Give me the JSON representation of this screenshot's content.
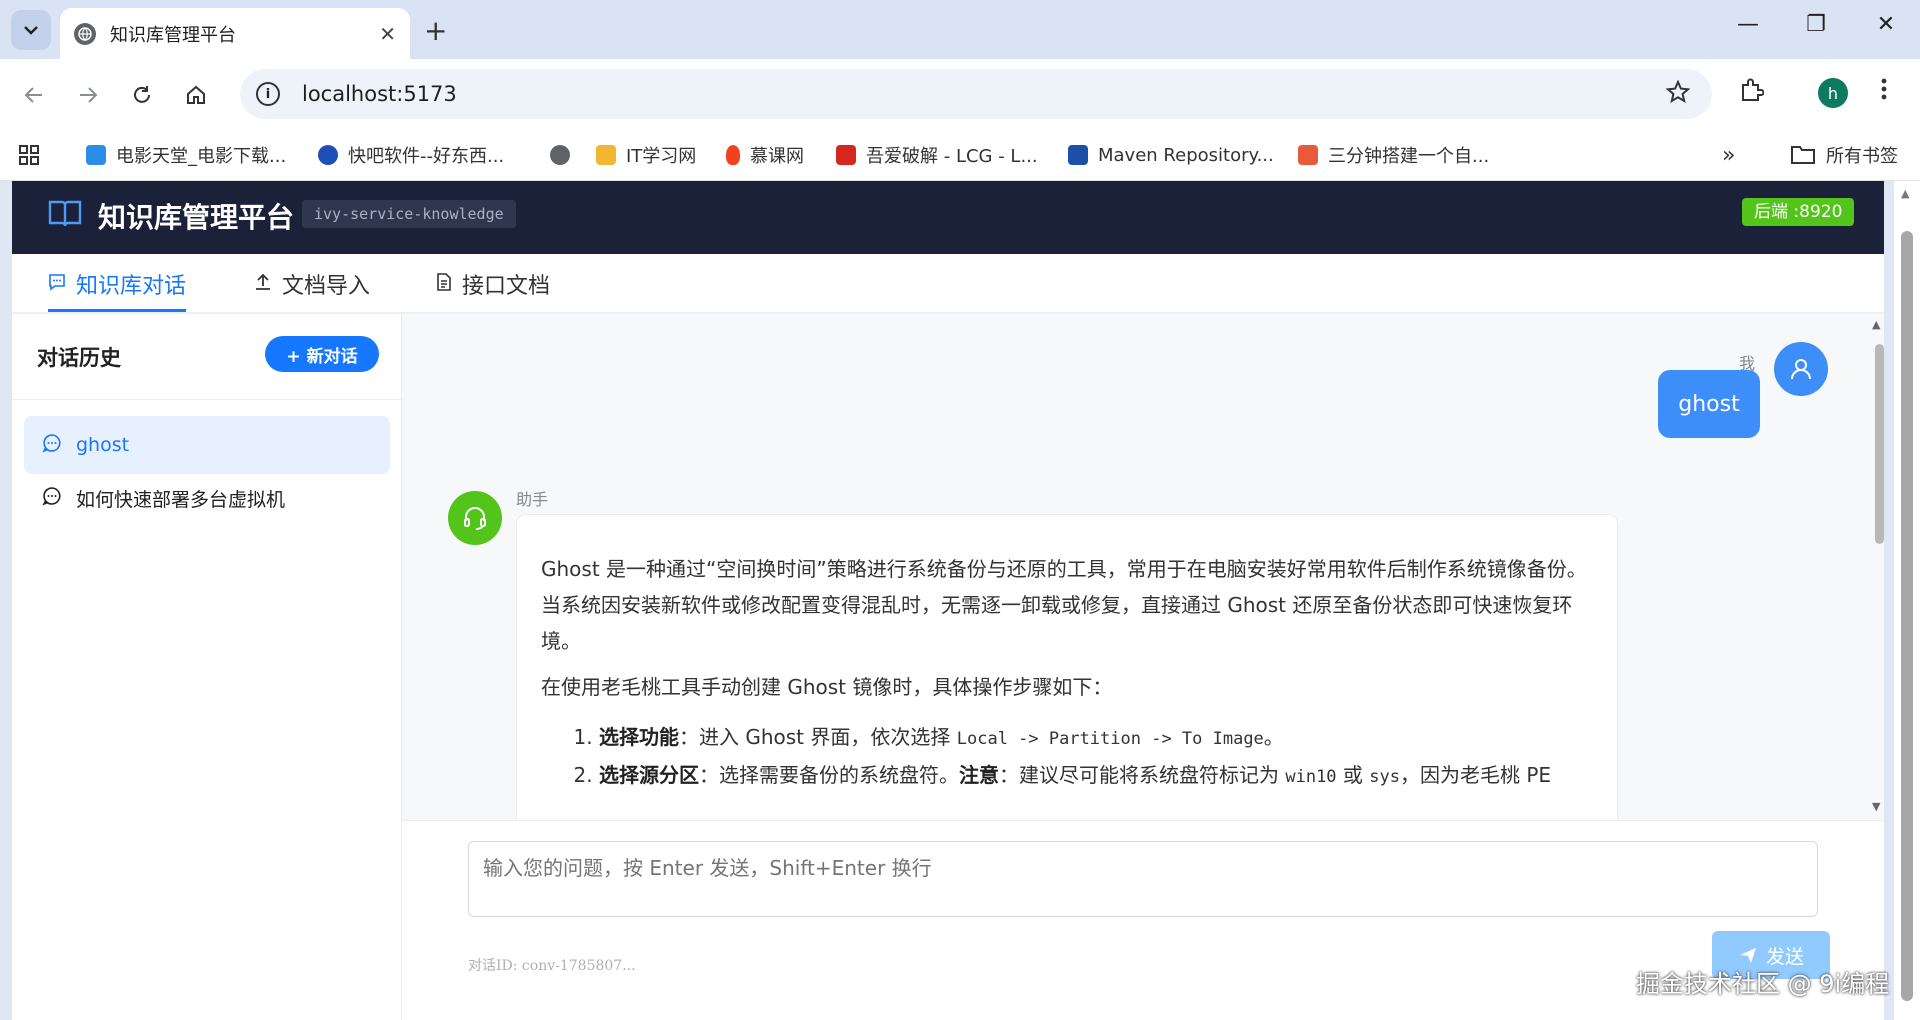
{
  "browser": {
    "tab_title": "知识库管理平台",
    "url": "localhost:5173",
    "profile_initial": "h",
    "bookmarks": [
      {
        "label": "电影天堂_电影下载...",
        "color": "#2b8de8"
      },
      {
        "label": "快吧软件--好东西...",
        "color": "#1e4fb8"
      },
      {
        "label": "",
        "color": "#5f6368"
      },
      {
        "label": "IT学习网",
        "color": "#f2b632"
      },
      {
        "label": "慕课网",
        "color": "#f0421c"
      },
      {
        "label": "吾爱破解 - LCG - L...",
        "color": "#d7261e"
      },
      {
        "label": "Maven Repository...",
        "color": "#1c4fa8"
      },
      {
        "label": "三分钟搭建一个自...",
        "color": "#e85a38"
      }
    ],
    "all_bookmarks": "所有书签"
  },
  "app": {
    "brand": "知识库管理平台",
    "service": "ivy-service-knowledge",
    "backend_port": "后端 :8920",
    "tabs": [
      {
        "label": "知识库对话",
        "active": true
      },
      {
        "label": "文档导入",
        "active": false
      },
      {
        "label": "接口文档",
        "active": false
      }
    ]
  },
  "sidebar": {
    "title": "对话历史",
    "new_chat": "+ 新对话",
    "conversations": [
      {
        "label": "ghost",
        "active": true
      },
      {
        "label": "如何快速部署多台虚拟机",
        "active": false
      }
    ]
  },
  "chat": {
    "user_label": "我",
    "user_message": "ghost",
    "assistant_label": "助手",
    "answer": {
      "para1": "Ghost 是一种通过“空间换时间”策略进行系统备份与还原的工具，常用于在电脑安装好常用软件后制作系统镜像备份。当系统因安装新软件或修改配置变得混乱时，无需逐一卸载或修复，直接通过 Ghost 还原至备份状态即可快速恢复环境。",
      "para2": "在使用老毛桃工具手动创建 Ghost 镜像时，具体操作步骤如下：",
      "step1_title": "选择功能",
      "step1_text": "：进入 Ghost 界面，依次选择 ",
      "step1_code": "Local -> Partition -> To Image",
      "step1_end": "。",
      "step2_title": "选择源分区",
      "step2_text": "：选择需要备份的系统盘符。",
      "step2_note": "注意",
      "step2_text2": "：建议尽可能将系统盘符标记为 ",
      "step2_code1": "win10",
      "step2_or": " 或 ",
      "step2_code2": "sys",
      "step2_text3": "，因为老毛桃 PE"
    }
  },
  "composer": {
    "placeholder": "输入您的问题，按 Enter 发送，Shift+Enter 换行",
    "conversation_id": "对话ID: conv-1785807...",
    "send": "发送"
  },
  "watermark": "掘金技术社区 @ 9i编程"
}
